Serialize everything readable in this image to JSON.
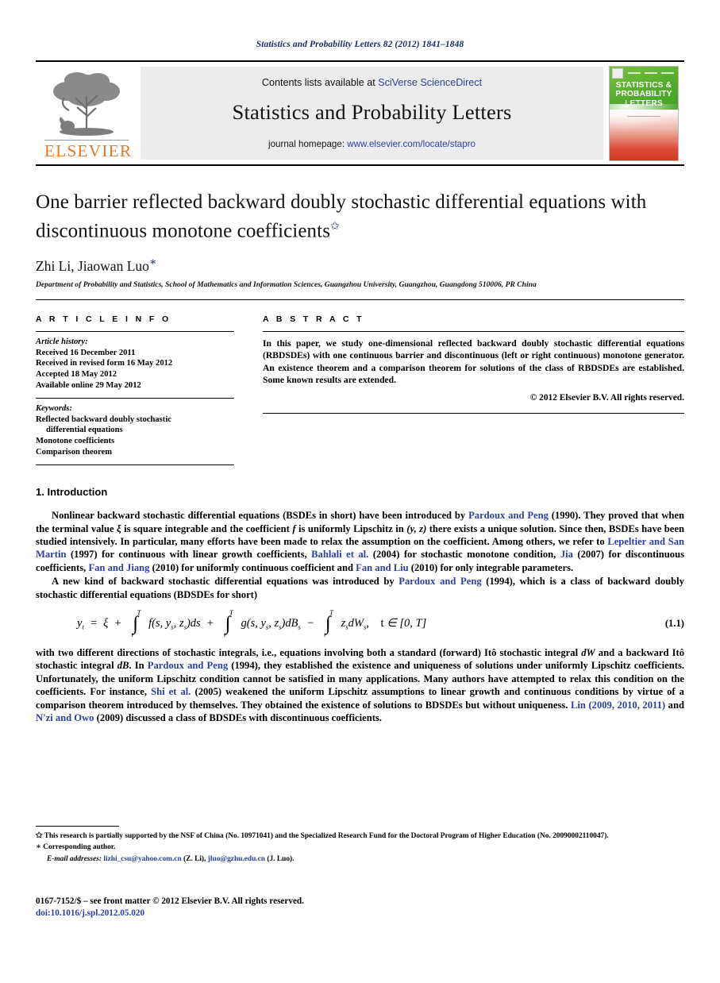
{
  "running_head": "Statistics and Probability Letters 82 (2012) 1841–1848",
  "masthead": {
    "publisher_name": "ELSEVIER",
    "contents_prefix": "Contents lists available at ",
    "contents_link": "SciVerse ScienceDirect",
    "journal_title": "Statistics and Probability Letters",
    "homepage_prefix": "journal homepage: ",
    "homepage_link": "www.elsevier.com/locate/stapro",
    "cover_title_line1": "STATISTICS &",
    "cover_title_line2": "PROBABILITY",
    "cover_title_line3": "LETTERS"
  },
  "article": {
    "title": "One barrier reflected backward doubly stochastic differential equations with discontinuous monotone coefficients",
    "title_footnote_mark": "✩",
    "authors": "Zhi Li, Jiaowan Luo",
    "corresponding_mark": "∗",
    "affiliation": "Department of Probability and Statistics, School of Mathematics and Information Sciences, Guangzhou University, Guangzhou, Guangdong 510006, PR China"
  },
  "info": {
    "heading": "A R T I C L E   I N F O",
    "history_label": "Article history:",
    "history": [
      "Received 16 December 2011",
      "Received in revised form 16 May 2012",
      "Accepted 18 May 2012",
      "Available online 29 May 2012"
    ],
    "keywords_label": "Keywords:",
    "keywords": [
      "Reflected backward doubly stochastic",
      "differential equations",
      "Monotone coefficients",
      "Comparison theorem"
    ]
  },
  "abstract": {
    "heading": "A B S T R A C T",
    "text": "In this paper, we study one-dimensional reflected backward doubly stochastic differential equations (RBDSDEs) with one continuous barrier and discontinuous (left or right continuous) monotone generator. An existence theorem and a comparison theorem for solutions of the class of RBDSDEs are established. Some known results are extended.",
    "copyright": "© 2012 Elsevier B.V. All rights reserved."
  },
  "introduction": {
    "heading": "1. Introduction",
    "p1_a": "Nonlinear backward stochastic differential equations (BSDEs in short) have been introduced by ",
    "p1_ref1": "Pardoux and Peng",
    "p1_b": " (1990). They proved that when the terminal value ",
    "p1_xi": "ξ",
    "p1_c": " is square integrable and the coefficient ",
    "p1_f": "f",
    "p1_d": " is uniformly Lipschitz in ",
    "p1_yz": "(y, z)",
    "p1_e": " there exists a unique solution. Since then, BSDEs have been studied intensively. In particular, many efforts have been made to relax the assumption on the coefficient. Among others, we refer to ",
    "p1_ref2": "Lepeltier and San Martin",
    "p1_f2": " (1997) for continuous with linear growth coefficients, ",
    "p1_ref3": "Bahlali et al.",
    "p1_g": " (2004) for stochastic monotone condition, ",
    "p1_ref4": "Jia",
    "p1_h": " (2007) for discontinuous coefficients, ",
    "p1_ref5": "Fan and Jiang",
    "p1_i": " (2010) for uniformly continuous coefficient and ",
    "p1_ref6": "Fan and Liu",
    "p1_j": " (2010) for only integrable parameters.",
    "p2_a": "A new kind of backward stochastic differential equations was introduced by ",
    "p2_ref1": "Pardoux and Peng",
    "p2_b": " (1994), which is a class of backward doubly stochastic differential equations (BDSDEs for short)",
    "p3_a": "with two different directions of stochastic integrals, i.e., equations involving both a standard (forward) Itô stochastic integral ",
    "p3_dW": "dW",
    "p3_b": " and a backward Itô stochastic integral ",
    "p3_dB": "dB",
    "p3_c": ". In ",
    "p3_ref1": "Pardoux and Peng",
    "p3_d": " (1994), they established the existence and uniqueness of solutions under uniformly Lipschitz coefficients. Unfortunately, the uniform Lipschitz condition cannot be satisfied in many applications. Many authors have attempted to relax this condition on the coefficients. For instance, ",
    "p3_ref2": "Shi et al.",
    "p3_e": " (2005) weakened the uniform Lipschitz assumptions to linear growth and continuous conditions by virtue of a comparison theorem introduced by themselves. They obtained the existence of solutions to BDSDEs but without uniqueness. ",
    "p3_ref3": "Lin",
    "p3_f": " (2009, 2010, 2011)",
    "p3_g": " and ",
    "p3_ref4": "N'zi and Owo",
    "p3_h": " (2009) discussed a class of BDSDEs with discontinuous coefficients."
  },
  "equation": {
    "number": "(1.1)",
    "lhs": "y",
    "lhs_sub": "t",
    "eq_sign": "=",
    "xi": "ξ",
    "plus1": "+",
    "int1_upper": "T",
    "int1_lower": "t",
    "int1_body": "f(s, y",
    "int1_body2": "z",
    "int1_body3": ")ds",
    "plus2": "+",
    "int2_upper": "T",
    "int2_lower": "t",
    "minus": "−",
    "int3_upper": "T",
    "int3_lower": "t",
    "domain": "t ∈ [0, T]",
    "full_text": "y_t = ξ + ∫_t^T f(s, y_s, z_s)ds + ∫_t^T g(s, y_s, z_s)dB_s − ∫_t^T z_s dW_s,  t ∈ [0, T]"
  },
  "footnotes": {
    "star_mark": "✩",
    "star_text": "This research is partially supported by the NSF of China (No. 10971041) and the Specialized Research Fund for the Doctoral Program of Higher Education (No. 20090002110047).",
    "corr_mark": "∗",
    "corr_text": "Corresponding author.",
    "email_label": "E-mail addresses:",
    "email1": "lizhi_csu@yahoo.com.cn",
    "email1_who": " (Z. Li), ",
    "email2": "jluo@gzhu.edu.cn",
    "email2_who": " (J. Luo)."
  },
  "bottom": {
    "issn_line": "0167-7152/$ – see front matter © 2012 Elsevier B.V. All rights reserved.",
    "doi": "doi:10.1016/j.spl.2012.05.020"
  },
  "colors": {
    "link": "#2b3fa0",
    "runhead": "#1b2a6b",
    "elsevier_orange": "#e87722",
    "cover_green": "#55ad2e",
    "cover_red": "#dc4a36"
  }
}
